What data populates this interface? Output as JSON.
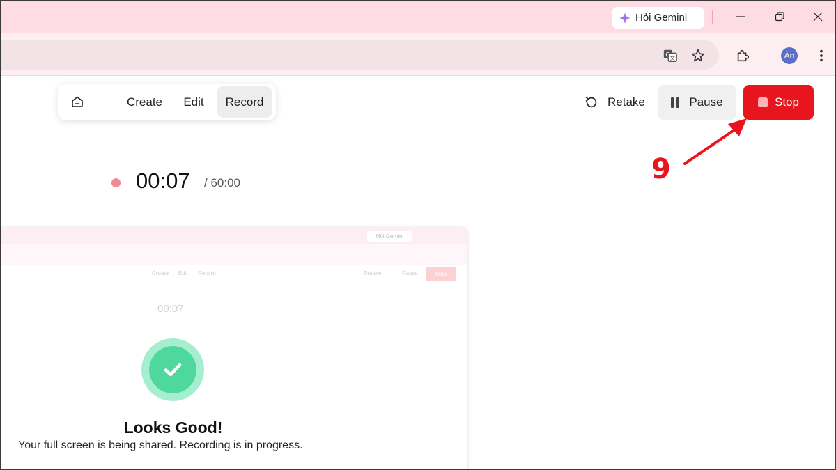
{
  "browser": {
    "gemini_label": "Hỏi Gemini",
    "avatar_initials": "Ân"
  },
  "nav": {
    "tabs": [
      {
        "label": "Create"
      },
      {
        "label": "Edit"
      },
      {
        "label": "Record",
        "active": true
      }
    ]
  },
  "controls": {
    "retake_label": "Retake",
    "pause_label": "Pause",
    "stop_label": "Stop"
  },
  "annotation": {
    "step_number": "9"
  },
  "timer": {
    "elapsed": "00:07",
    "total": "/ 60:00"
  },
  "preview": {
    "gemini_label": "Hỏi Gemini",
    "nav_create": "Create",
    "nav_edit": "Edit",
    "nav_record": "Record",
    "retake_label": "Retake",
    "pause_label": "Pause",
    "stop_label": "Stop",
    "timer": "00:07",
    "status_title": "Looks Good!",
    "status_message": "Your full screen is being shared. Recording is in progress."
  },
  "colors": {
    "accent_red": "#e8151f",
    "titlebar_pink": "#fddde3",
    "success_green": "#4fd89e"
  },
  "icons": [
    "gemini-icon",
    "minimize-icon",
    "maximize-icon",
    "close-icon",
    "translate-icon",
    "star-icon",
    "extensions-icon",
    "more-icon",
    "home-icon",
    "retake-icon",
    "pause-icon",
    "stop-icon",
    "check-icon"
  ]
}
